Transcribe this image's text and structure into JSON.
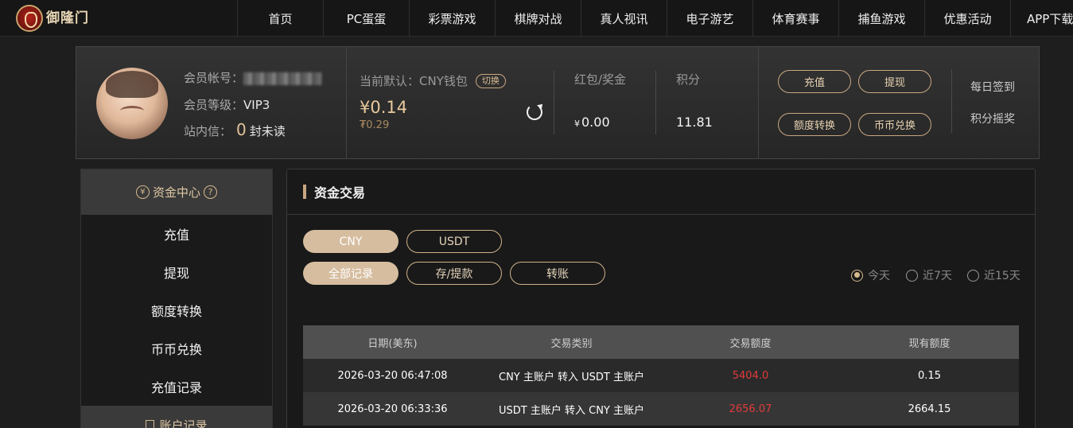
{
  "nav": {
    "logo_text": "御隆门",
    "items": [
      {
        "label": "首页"
      },
      {
        "label": "PC蛋蛋"
      },
      {
        "label": "彩票游戏"
      },
      {
        "label": "棋牌对战"
      },
      {
        "label": "真人视讯"
      },
      {
        "label": "电子游艺"
      },
      {
        "label": "体育赛事"
      },
      {
        "label": "捕鱼游戏"
      },
      {
        "label": "优惠活动"
      },
      {
        "label": "APP下载"
      }
    ]
  },
  "account": {
    "member_label": "会员帐号：",
    "level_label": "会员等级：",
    "level_value": "VIP3",
    "inbox_label": "站内信：",
    "inbox_count": "0",
    "inbox_suffix": "封未读",
    "wallet_label": "当前默认：CNY钱包",
    "switch_label": "切换",
    "balance": "¥0.14",
    "balance_sub": "₮0.29",
    "bonus_label": "红包/奖金",
    "bonus_currency": "¥",
    "bonus_value": "0.00",
    "points_label": "积分",
    "points_value": "11.81",
    "buttons": {
      "recharge": "充值",
      "withdraw": "提现",
      "transfer": "额度转换",
      "exchange": "币币兑换"
    },
    "daily_signin": "每日签到",
    "points_lottery": "积分摇奖"
  },
  "sidebar": {
    "header": "资金中心",
    "header_currency_glyph": "¥",
    "help_glyph": "?",
    "items": [
      {
        "label": "充值"
      },
      {
        "label": "提现"
      },
      {
        "label": "额度转换"
      },
      {
        "label": "币币兑换"
      },
      {
        "label": "充值记录"
      }
    ],
    "header2": "账户记录"
  },
  "main": {
    "title": "资金交易",
    "currency_tabs": [
      {
        "label": "CNY",
        "active": true
      },
      {
        "label": "USDT",
        "active": false
      }
    ],
    "type_tabs": [
      {
        "label": "全部记录",
        "active": true
      },
      {
        "label": "存/提款",
        "active": false
      },
      {
        "label": "转账",
        "active": false
      }
    ],
    "ranges": [
      {
        "label": "今天",
        "selected": true
      },
      {
        "label": "近7天",
        "selected": false
      },
      {
        "label": "近15天",
        "selected": false
      }
    ],
    "table": {
      "headers": [
        "日期(美东)",
        "交易类别",
        "交易额度",
        "现有额度"
      ],
      "rows": [
        {
          "date": "2026-03-20 06:47:08",
          "type": "CNY 主账户 转入 USDT 主账户",
          "amount": "5404.0",
          "balance": "0.15"
        },
        {
          "date": "2026-03-20 06:33:36",
          "type": "USDT 主账户 转入 CNY 主账户",
          "amount": "2656.07",
          "balance": "2664.15"
        }
      ]
    }
  },
  "colors": {
    "accent_gold": "#c9a680",
    "amount_red": "#e23b3b"
  }
}
